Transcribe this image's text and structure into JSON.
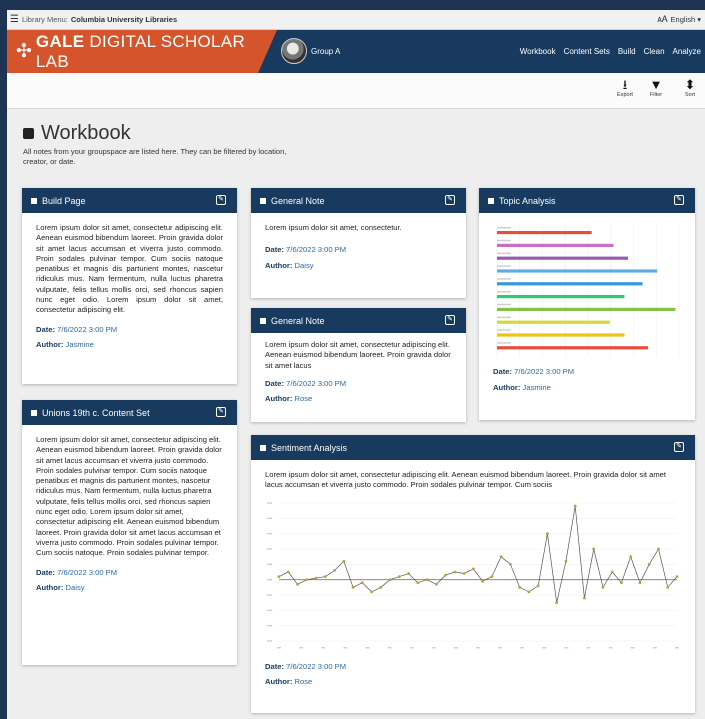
{
  "library_bar": {
    "menu_label": "Library Menu:",
    "library_name": "Columbia University Libraries",
    "language": "English ▾"
  },
  "brand": {
    "name_bold": "GALE",
    "name_rest": " DIGITAL SCHOLAR LAB"
  },
  "group": {
    "name": "Group A"
  },
  "nav": [
    "Workbook",
    "Content Sets",
    "Build",
    "Clean",
    "Analyze"
  ],
  "toolbar": {
    "export": "Export",
    "filter": "Filter",
    "sort": "Sort"
  },
  "page": {
    "title": "Workbook",
    "subtitle": "All notes from your groupspace are listed here. They can be filtered by location, creator, or date."
  },
  "meta_labels": {
    "date": "Date:",
    "author": "Author:"
  },
  "cards": [
    {
      "title": "Build Page",
      "text": "Lorem ipsum dolor sit amet, consectetur adipiscing elit. Aenean euismod bibendum laoreet. Proin gravida dolor sit amet lacus accumsan et viverra justo commodo. Proin sodales pulvinar tempor. Cum sociis natoque penatibus et magnis dis parturient montes, nascetur ridiculus mus. Nam fermentum, nulla luctus pharetra vulputate, felis tellus mollis orci, sed rhoncus sapien nunc eget odio. Lorem ipsum dolor sit amet, consectetur adipiscing elit.",
      "date": "7/6/2022 3:00 PM",
      "author": "Jasmine"
    },
    {
      "title": "Unions 19th c. Content Set",
      "text": "Lorem ipsum dolor sit amet, consectetur adipiscing elit. Aenean euismod bibendum laoreet. Proin gravida dolor sit amet lacus accumsan et viverra justo commodo. Proin sodales pulvinar tempor. Cum sociis natoque penatibus et magnis dis parturient montes, nascetur ridiculus mus. Nam fermentum, nulla luctus pharetra vulputate, felis tellus mollis orci, sed rhoncus sapien nunc eget odio. Lorem ipsum dolor sit amet, consectetur adipiscing elit. Aenean euismod bibendum laoreet. Proin gravida dolor sit amet lacus accumsan et viverra justo commodo. Proin sodales pulvinar tempor. Cum sociis natoque. Proin sodales pulvinar tempor.",
      "date": "7/6/2022 3:00 PM",
      "author": "Daisy"
    },
    {
      "title": "General Note",
      "text": "Lorem ipsum dolor sit amet, consectetur.",
      "date": "7/6/2022 3:00 PM",
      "author": "Daisy"
    },
    {
      "title": "General Note",
      "text": "Lorem ipsum dolor sit amet, consectetur adipiscing elit. Aenean euismod bibendum laoreet. Proin gravida dolor sit amet lacus",
      "date": "7/6/2022 3:00 PM",
      "author": "Rose"
    },
    {
      "title": "Topic Analysis",
      "date": "7/6/2022 3:00 PM",
      "author": "Jasmine"
    },
    {
      "title": "Sentiment Analysis",
      "text": "Lorem ipsum dolor sit amet, consectetur adipiscing elit. Aenean euismod bibendum laoreet. Proin gravida dolor sit amet lacus accumsan et viverra justo commodo. Proin sodales pulvinar tempor. Cum sociis",
      "date": "7/6/2022 3:00 PM",
      "author": "Rose"
    }
  ],
  "colors": {
    "brand_orange": "#d6542c",
    "navy": "#173a5e",
    "link_blue": "#2c6aa0"
  },
  "chart_data": [
    {
      "type": "bar",
      "orientation": "horizontal",
      "values": [
        0.52,
        0.64,
        0.72,
        0.88,
        0.8,
        0.7,
        0.98,
        0.62,
        0.7,
        0.83
      ],
      "colors": [
        "#e94b3c",
        "#c86fc3",
        "#9b59b6",
        "#5dade2",
        "#3498db",
        "#2ecc71",
        "#82c341",
        "#d4d93a",
        "#f1c40f",
        "#e74c3c"
      ]
    },
    {
      "type": "line",
      "values": [
        0.02,
        0.05,
        -0.03,
        0.0,
        0.01,
        0.02,
        0.06,
        0.12,
        -0.05,
        -0.02,
        -0.08,
        -0.05,
        0.0,
        0.02,
        0.04,
        -0.02,
        0.0,
        -0.03,
        0.03,
        0.05,
        0.04,
        0.07,
        -0.01,
        0.02,
        0.15,
        0.1,
        -0.05,
        -0.08,
        -0.04,
        0.3,
        -0.15,
        0.12,
        0.48,
        -0.12,
        0.2,
        -0.05,
        0.05,
        -0.02,
        0.15,
        -0.02,
        0.1,
        0.2,
        -0.05,
        0.02
      ],
      "baseline": 0,
      "marker_color": "#b8a23a",
      "line_color": "#555555"
    }
  ]
}
